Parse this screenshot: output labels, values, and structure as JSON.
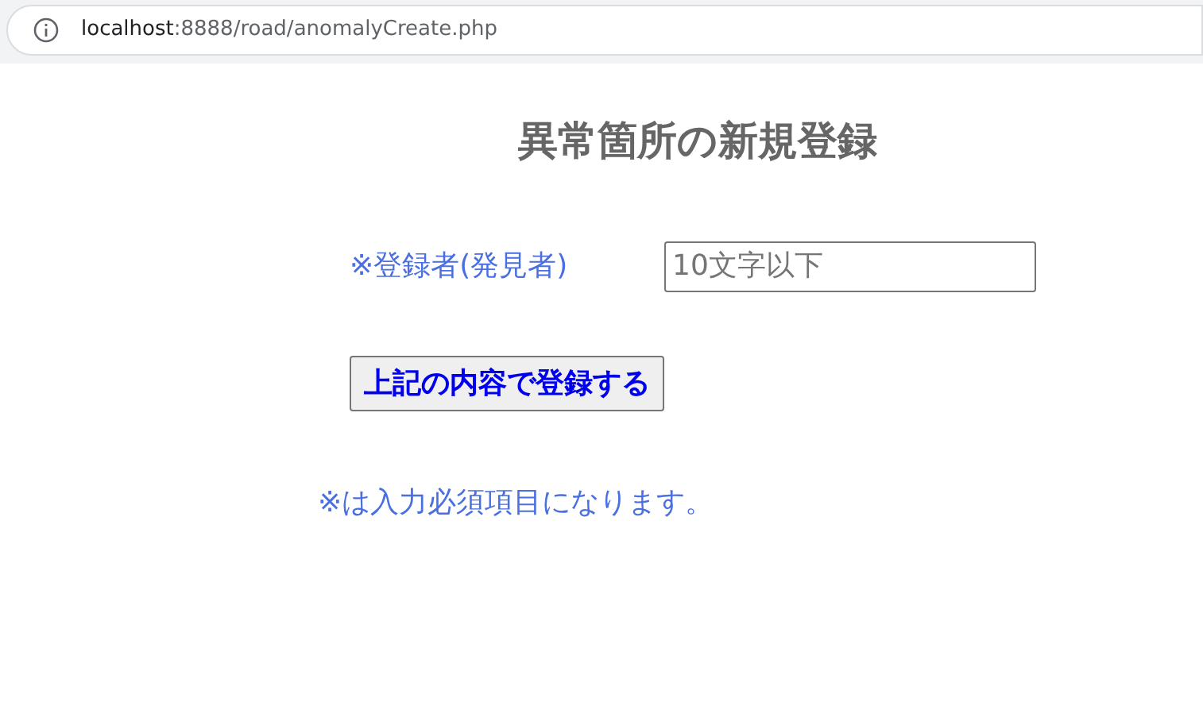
{
  "address_bar": {
    "host": "localhost",
    "path": ":8888/road/anomalyCreate.php"
  },
  "title": "異常箇所の新規登録",
  "form": {
    "label": "※登録者(発見者)",
    "placeholder": "10文字以下"
  },
  "submit_button": "上記の内容で登録する",
  "note": "※は入力必須項目になります。"
}
